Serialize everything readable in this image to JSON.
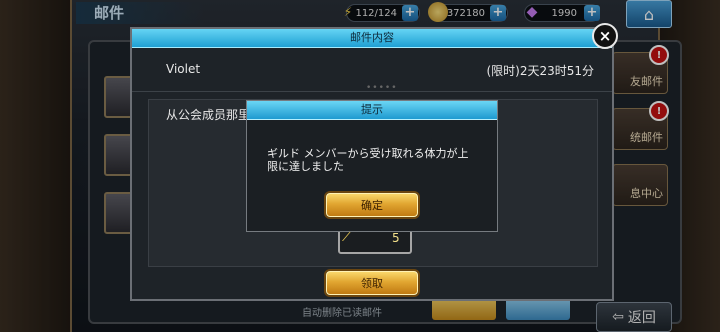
{
  "hud": {
    "screen_title": "邮件",
    "stamina": "112/124",
    "gold": "372180",
    "gems": "1990"
  },
  "side_tabs": [
    {
      "label": "友邮件",
      "alert": "!"
    },
    {
      "label": "统邮件",
      "alert": "!"
    },
    {
      "label": "息中心",
      "alert": ""
    }
  ],
  "bottom_bar": {
    "auto_delete_label": "自动删除已读邮件",
    "back_label": "返回"
  },
  "mail_dialog": {
    "title": "邮件内容",
    "close_symbol": "×",
    "sender": "Violet",
    "expiry": "(限时)2天23时51分",
    "divider": "•••••",
    "body_text": "从公会成员那里",
    "attachment": {
      "icon": "stamina-icon",
      "count": "5"
    },
    "claim_label": "领取"
  },
  "prompt_dialog": {
    "title": "提示",
    "message": "ギルド メンバーから受け取れる体力が上限に達しました",
    "confirm_label": "确定"
  },
  "colors": {
    "header_cyan": "#1fa0d3",
    "gold_button": "#e1a631",
    "alert_red": "#c41212"
  }
}
